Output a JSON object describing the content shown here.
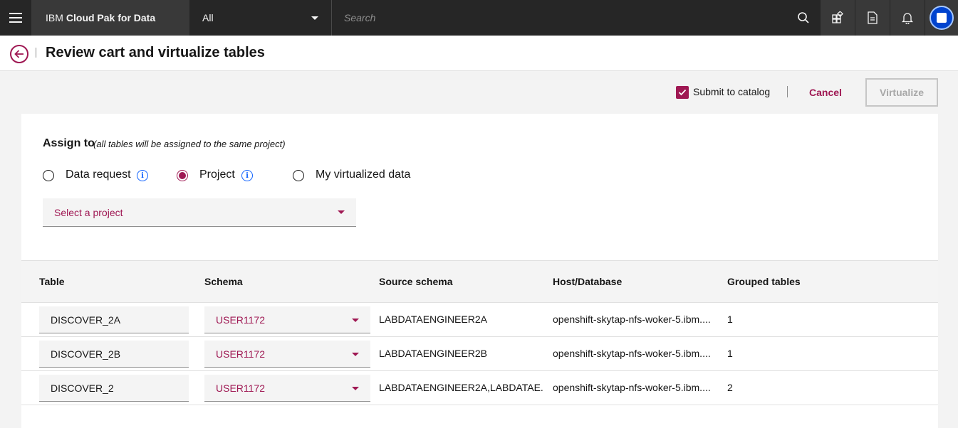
{
  "nav": {
    "brand_prefix": "IBM",
    "brand_name": "Cloud Pak for Data",
    "scope_value": "All",
    "search_placeholder": "Search",
    "icons": [
      "menu-icon",
      "search-icon",
      "apps-icon",
      "document-icon",
      "notification-icon",
      "user-avatar"
    ]
  },
  "header": {
    "title": "Review cart and virtualize tables"
  },
  "actions": {
    "submit_to_catalog_label": "Submit to catalog",
    "submit_to_catalog_checked": true,
    "cancel_label": "Cancel",
    "virtualize_label": "Virtualize"
  },
  "assign": {
    "label": "Assign to",
    "note": "(all tables will be assigned to the same project)",
    "options": [
      {
        "label": "Data request",
        "checked": false,
        "has_info": true
      },
      {
        "label": "Project",
        "checked": true,
        "has_info": true
      },
      {
        "label": "My virtualized data",
        "checked": false,
        "has_info": false
      }
    ],
    "project_select_placeholder": "Select a project"
  },
  "table": {
    "columns": [
      "Table",
      "Schema",
      "Source schema",
      "Host/Database",
      "Grouped tables"
    ],
    "rows": [
      {
        "table": "DISCOVER_2A",
        "schema": "USER1172",
        "source_schema": "LABDATAENGINEER2A",
        "host": "openshift-skytap-nfs-woker-5.ibm....",
        "grouped": "1"
      },
      {
        "table": "DISCOVER_2B",
        "schema": "USER1172",
        "source_schema": "LABDATAENGINEER2B",
        "host": "openshift-skytap-nfs-woker-5.ibm....",
        "grouped": "1"
      },
      {
        "table": "DISCOVER_2",
        "schema": "USER1172",
        "source_schema": "LABDATAENGINEER2A,LABDATAE...",
        "host": "openshift-skytap-nfs-woker-5.ibm....",
        "grouped": "2"
      }
    ]
  },
  "colors": {
    "accent": "#9f1853",
    "nav_bg": "#262626",
    "info": "#0f62fe"
  }
}
